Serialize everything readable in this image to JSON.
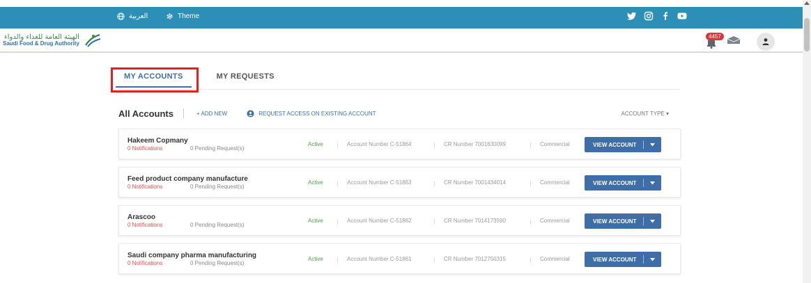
{
  "topbar": {
    "language_label": "العربية",
    "theme_label": "Theme",
    "bg_color": "#2d8fb8",
    "social_icons": [
      "twitter-icon",
      "instagram-icon",
      "facebook-icon",
      "youtube-icon"
    ]
  },
  "header": {
    "logo_ar": "الهيئة العامة للغذاء والدواء",
    "logo_en": "Saudi Food & Drug Authority",
    "notification_count": "4457"
  },
  "tabs": [
    {
      "label": "MY ACCOUNTS",
      "active": true
    },
    {
      "label": "MY REQUESTS",
      "active": false
    }
  ],
  "toolbar": {
    "title": "All Accounts",
    "add_new": "+  ADD NEW",
    "request_access": "REQUEST ACCESS ON EXISTING ACCOUNT",
    "account_type": "ACCOUNT TYPE ▾"
  },
  "accounts": [
    {
      "name": "Hakeem Copmany",
      "notifications": "0 Notifications",
      "pending": "0 Pending Request(s)",
      "status": "Active",
      "account_number": "Account Number C-51864",
      "cr_number": "CR Number 7001630099",
      "type": "Commercial",
      "button": "VIEW ACCOUNT"
    },
    {
      "name": "Feed product company manufacture",
      "notifications": "0 Notifications",
      "pending": "0 Pending Request(s)",
      "status": "Active",
      "account_number": "Account Number C-51863",
      "cr_number": "CR Number 7001434014",
      "type": "Commercial",
      "button": "VIEW ACCOUNT"
    },
    {
      "name": "Arascoo",
      "notifications": "0 Notifications",
      "pending": "0 Pending Request(s)",
      "status": "Active",
      "account_number": "Account Number C-51862",
      "cr_number": "CR Number 7014173590",
      "type": "Commercial",
      "button": "VIEW ACCOUNT"
    },
    {
      "name": "Saudi company pharma manufacturing",
      "notifications": "0 Notifications",
      "pending": "0 Pending Request(s)",
      "status": "Active",
      "account_number": "Account Number C-51861",
      "cr_number": "CR Number 7012750315",
      "type": "Commercial",
      "button": "VIEW ACCOUNT"
    }
  ],
  "colors": {
    "primary": "#3d6ea8",
    "active_green": "#4aa04a",
    "notification_red": "#e05050",
    "highlight_red": "#e32020"
  }
}
